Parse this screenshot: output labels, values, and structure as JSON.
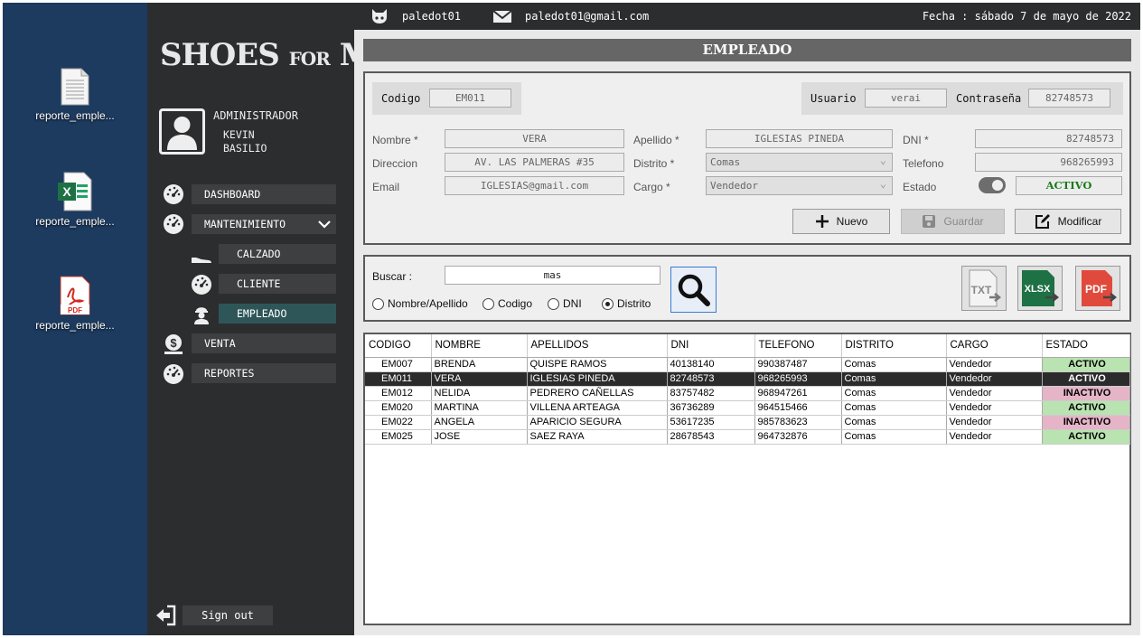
{
  "desktop": {
    "icons": [
      {
        "name": "report-txt",
        "label": "reporte_emple..."
      },
      {
        "name": "report-xlsx",
        "label": "reporte_emple..."
      },
      {
        "name": "report-pdf",
        "label": "reporte_emple..."
      }
    ]
  },
  "sidebar": {
    "logo_main1": "SHOES ",
    "logo_small": "FOR",
    "logo_main2": " MEN",
    "role": "ADMINISTRADOR",
    "first_name": "KEVIN",
    "last_name": "BASILIO",
    "nav": {
      "dashboard": "DASHBOARD",
      "mantenimiento": "MANTENIMIENTO",
      "calzado": "CALZADO",
      "cliente": "CLIENTE",
      "empleado": "EMPLEADO",
      "venta": "VENTA",
      "reportes": "REPORTES"
    },
    "signout": "Sign out"
  },
  "topbar": {
    "username": "paledot01",
    "email": "paledot01@gmail.com",
    "date": "Fecha : sábado 7 de mayo de 2022"
  },
  "form": {
    "title": "EMPLEADO",
    "codigo_label": "Codigo",
    "codigo_value": "EM011",
    "usuario_label": "Usuario",
    "usuario_value": "verai",
    "password_label": "Contraseña",
    "password_value": "82748573",
    "nombre_label": "Nombre *",
    "nombre_value": "VERA",
    "apellido_label": "Apellido *",
    "apellido_value": "IGLESIAS PINEDA",
    "dni_label": "DNI *",
    "dni_value": "82748573",
    "direccion_label": "Direccion",
    "direccion_value": "AV. LAS PALMERAS #35",
    "distrito_label": "Distrito *",
    "distrito_value": "Comas",
    "telefono_label": "Telefono",
    "telefono_value": "968265993",
    "email_label": "Email",
    "email_value": "IGLESIAS@gmail.com",
    "cargo_label": "Cargo *",
    "cargo_value": "Vendedor",
    "estado_label": "Estado",
    "estado_value": "ACTIVO",
    "nuevo": "Nuevo",
    "guardar": "Guardar",
    "modificar": "Modificar"
  },
  "search": {
    "label": "Buscar :",
    "value": "mas",
    "options": [
      "Nombre/Apellido",
      "Codigo",
      "DNI",
      "Distrito"
    ],
    "selected": "Distrito",
    "export": [
      "TXT",
      "XLSX",
      "PDF"
    ]
  },
  "table": {
    "headers": [
      "CODIGO",
      "NOMBRE",
      "APELLIDOS",
      "DNI",
      "TELEFONO",
      "DISTRITO",
      "CARGO",
      "ESTADO"
    ],
    "rows": [
      [
        "EM007",
        "BRENDA",
        "QUISPE RAMOS",
        "40138140",
        "990387487",
        "Comas",
        "Vendedor",
        "ACTIVO"
      ],
      [
        "EM011",
        "VERA",
        "IGLESIAS PINEDA",
        "82748573",
        "968265993",
        "Comas",
        "Vendedor",
        "ACTIVO"
      ],
      [
        "EM012",
        "NELIDA",
        "PEDRERO CAÑELLAS",
        "83757482",
        "968947261",
        "Comas",
        "Vendedor",
        "INACTIVO"
      ],
      [
        "EM020",
        "MARTINA",
        "VILLENA ARTEAGA",
        "36736289",
        "964515466",
        "Comas",
        "Vendedor",
        "ACTIVO"
      ],
      [
        "EM022",
        "ANGELA",
        "APARICIO SEGURA",
        "53617235",
        "985783623",
        "Comas",
        "Vendedor",
        "INACTIVO"
      ],
      [
        "EM025",
        "JOSE",
        "SAEZ RAYA",
        "28678543",
        "964732876",
        "Comas",
        "Vendedor",
        "ACTIVO"
      ]
    ],
    "selected_row": 1
  },
  "colors": {
    "sidebar_bg": "#2c2d2f",
    "desktop_bg": "#1d3a5f",
    "active_nav": "#2e5658",
    "activo": "#b9e3b0",
    "inactivo": "#e5b5c7",
    "estado_text": "#1a7a1a"
  }
}
